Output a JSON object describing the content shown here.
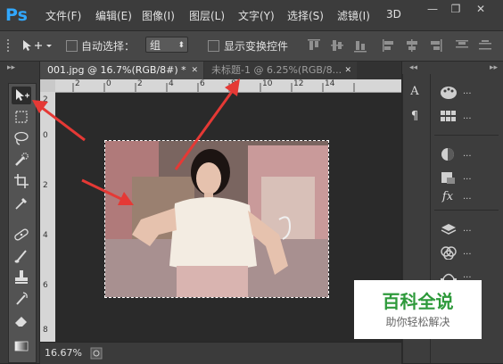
{
  "app": {
    "logo_text": "Ps"
  },
  "menu": [
    "文件(F)",
    "编辑(E)",
    "图像(I)",
    "图层(L)",
    "文字(Y)",
    "选择(S)",
    "滤镜(I)",
    "3D"
  ],
  "window_controls": [
    "—",
    "❐",
    "✕"
  ],
  "options": {
    "auto_select_label": "自动选择：",
    "group_value": "组",
    "show_transform_label": "显示变换控件"
  },
  "tabs": [
    {
      "label": "001.jpg @ 16.7%(RGB/8#) *",
      "close": "✕"
    },
    {
      "label": "未标题-1 @ 6.25%(RGB/8...",
      "close": "✕"
    }
  ],
  "ruler_top_ticks": [
    "2",
    "0",
    "2",
    "4",
    "6",
    "8",
    "10",
    "12",
    "14"
  ],
  "ruler_left_ticks": [
    "2",
    "0",
    "2",
    "4",
    "6",
    "8"
  ],
  "status": {
    "zoom": "16.67%"
  },
  "tools": [
    "move",
    "marquee",
    "lasso",
    "quick-select",
    "crop",
    "eyedropper",
    "healing",
    "brush",
    "stamp",
    "history-brush",
    "eraser",
    "gradient"
  ],
  "right_panel_icons": [
    "paint-palette-icon",
    "swatches-icon",
    "adjustments-icon",
    "styles-icon",
    "fx-icon",
    "layers-icon",
    "channels-icon",
    "paths-icon"
  ],
  "right_panel_dots": "...",
  "watermark": {
    "title": "百科全说",
    "subtitle": "助你轻松解决"
  },
  "colors": {
    "accent": "#31a8ff",
    "arrow": "#e53935",
    "watermark_green": "#2e9a3b"
  }
}
